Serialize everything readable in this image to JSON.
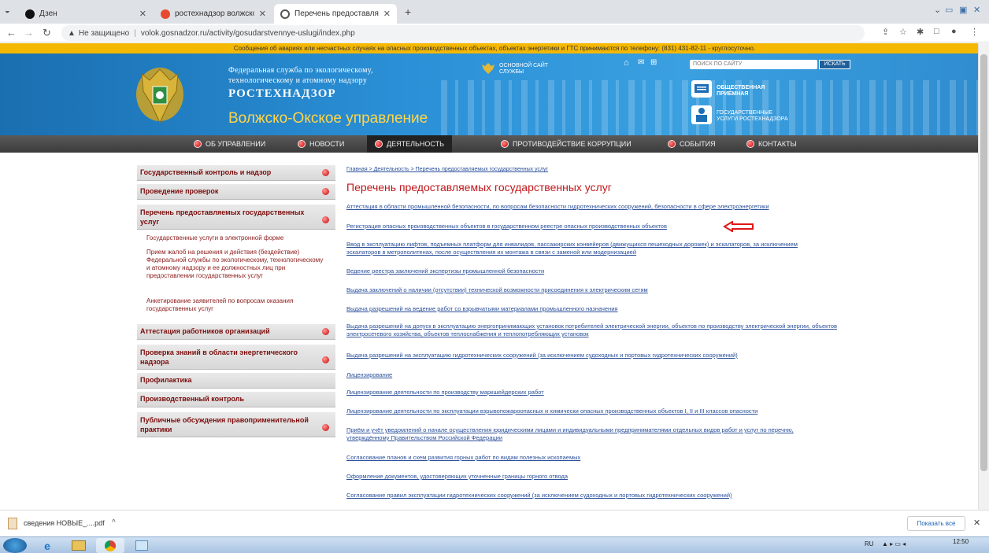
{
  "browser": {
    "tabs": [
      {
        "label": "Дзен"
      },
      {
        "label": "ростехнадзор волжско-окское"
      },
      {
        "label": "Перечень предоставляемых го"
      }
    ],
    "url_warning": "Не защищено",
    "url": "volok.gosnadzor.ru/activity/gosudarstvennye-uslugi/index.php"
  },
  "notice": "Сообщения об авариях или несчастных случаях на опасных производственных объектах, объектах энергетики и ГТС принимаются по телефону: (831) 431-82-11 - круглосуточно.",
  "header": {
    "fed_line1": "Федеральная служба по экологическому,",
    "fed_line2": "технологическому и атомному надзору",
    "rostech": "РОСТЕХНАДЗОР",
    "region": "Волжско-Окское управление",
    "main_site_line1": "ОСНОВНОЙ САЙТ",
    "main_site_line2": "СЛУЖБЫ",
    "search_placeholder": "ПОИСК ПО САЙТУ",
    "search_button": "ИСКАТЬ",
    "reception_line1": "ОБЩЕСТВЕННАЯ",
    "reception_line2": "ПРИЕМНАЯ",
    "services_line1": "ГОСУДАРСТВЕННЫЕ",
    "services_line2": "УСЛУГИ РОСТЕХНАДЗОРА"
  },
  "menu": [
    {
      "label": "ОБ УПРАВЛЕНИИ"
    },
    {
      "label": "НОВОСТИ"
    },
    {
      "label": "ДЕЯТЕЛЬНОСТЬ"
    },
    {
      "label": "ПРОТИВОДЕЙСТВИЕ КОРРУПЦИИ"
    },
    {
      "label": "СОБЫТИЯ"
    },
    {
      "label": "КОНТАКТЫ"
    }
  ],
  "sidebar": {
    "items": [
      {
        "label": "Государственный контроль и надзор"
      },
      {
        "label": "Проведение проверок"
      },
      {
        "label": "Перечень предоставляемых государственных услуг"
      },
      {
        "label": "Аттестация работников организаций"
      },
      {
        "label": "Проверка знаний в области энергетического надзора"
      },
      {
        "label": "Профилактика"
      },
      {
        "label": "Производственный контроль"
      },
      {
        "label": "Публичные обсуждения правоприменительной практики"
      }
    ],
    "subitems": [
      {
        "label": "Государственные услуги в электронной форме"
      },
      {
        "label": "Прием жалоб на решения и действия (бездействие) Федеральной службы по экологическому, технологическому и атомному надзору и ее должностных лиц при предоставлении государственных услуг"
      },
      {
        "label": "Анкетирование заявителей по вопросам оказания государственных услуг"
      }
    ]
  },
  "content": {
    "breadcrumb": "Главная > Деятельность > Перечень предоставляемых государственных услуг",
    "title": "Перечень предоставляемых государственных услуг",
    "links": [
      {
        "label": "Аттестация в области промышленной безопасности, по вопросам безопасности гидротехнических сооружений, безопасности в сфере электроэнергетики"
      },
      {
        "label": "Регистрация опасных производственных объектов в государственном реестре опасных производственных объектов"
      },
      {
        "label": "Ввод в эксплуатацию лифтов, подъемных платформ для инвалидов, пассажирских конвейеров (движущихся пешеходных дорожек) и эскалаторов, за исключением эскалаторов в метрополитенах, после осуществления их монтажа в связи с заменой или модернизацией"
      },
      {
        "label": "Ведение реестра заключений экспертизы промышленной безопасности"
      },
      {
        "label": "Выдача заключений о наличии (отсутствии) технической возможности присоединения к электрическим сетям"
      },
      {
        "label": "Выдача разрешений на ведение работ со взрывчатыми материалами промышленного назначения"
      },
      {
        "label": "Выдача разрешений на допуск в эксплуатацию энергопринимающих установок потребителей электрической энергии, объектов по производству электрической энергии, объектов электросетевого хозяйства, объектов теплоснабжения и теплопотребляющих установок"
      },
      {
        "label": "Выдача разрешений на эксплуатацию гидротехнических сооружений (за исключением судоходных и портовых гидротехнических сооружений)"
      },
      {
        "label": "Лицензирование"
      },
      {
        "label": "Лицензирование деятельности по производству маркшейдерских работ"
      },
      {
        "label": "Лицензирование деятельности по эксплуатации взрывопожароопасных и химически опасных производственных объектов I, II и III классов опасности"
      },
      {
        "label": "Приём и учёт уведомлений о начале осуществления юридическими лицами и индивидуальными предпринимателями отдельных видов работ и услуг по перечню, утверждённому Правительством Российской Федерации"
      },
      {
        "label": "Согласование планов и схем развития горных работ по видам полезных ископаемых"
      },
      {
        "label": "Оформление документов, удостоверяющих уточненные границы горного отвода"
      },
      {
        "label": "Согласование правил эксплуатации гидротехнических сооружений (за исключением судоходных и портовых гидротехнических сооружений)"
      }
    ]
  },
  "downloads": {
    "file": "сведения НОВЫЕ_....pdf",
    "show_all": "Показать все"
  },
  "taskbar": {
    "lang": "RU",
    "time": "12:50"
  }
}
